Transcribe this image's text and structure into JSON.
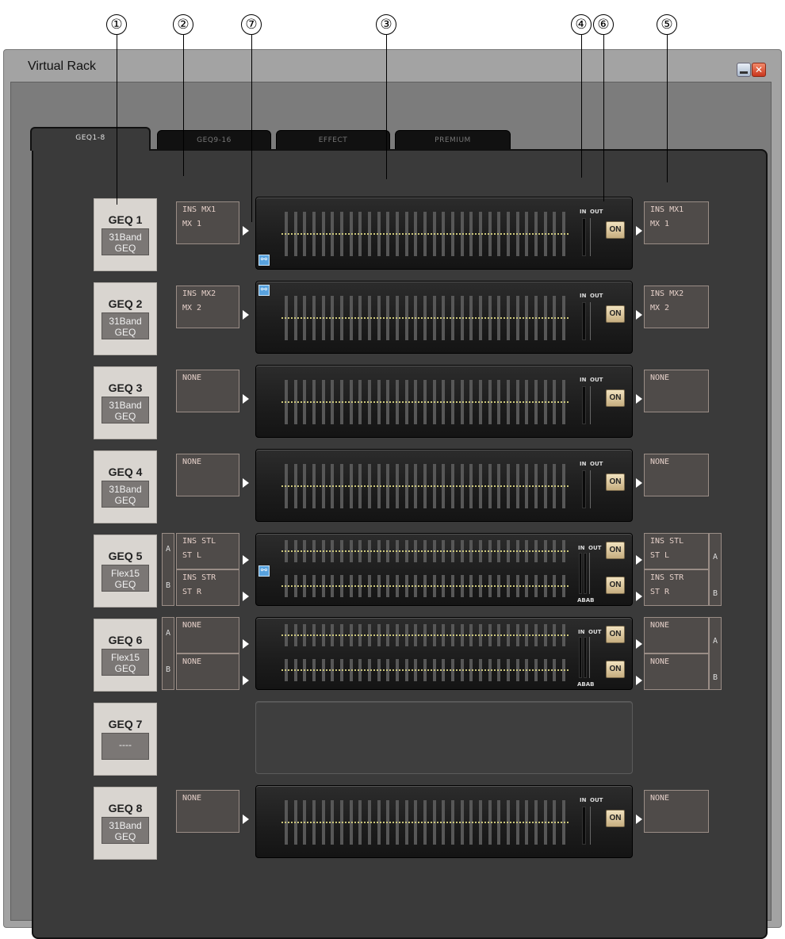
{
  "callouts": [
    "①",
    "②",
    "⑦",
    "③",
    "④",
    "⑥",
    "⑤"
  ],
  "window": {
    "title": "Virtual Rack"
  },
  "tabs": [
    "GEQ1-8",
    "GEQ9-16",
    "EFFECT",
    "PREMIUM"
  ],
  "on_label": "ON",
  "meter_in": "IN",
  "meter_out": "OUT",
  "ab": [
    "A",
    "B"
  ],
  "meter_ab": "ABAB",
  "geqs": [
    {
      "name": "GEQ 1",
      "type_l1": "31Band",
      "type_l2": "GEQ",
      "in_l1": "INS MX1",
      "in_l2": "MX 1",
      "out_l1": "INS MX1",
      "out_l2": "MX 1"
    },
    {
      "name": "GEQ 2",
      "type_l1": "31Band",
      "type_l2": "GEQ",
      "in_l1": "INS MX2",
      "in_l2": "MX 2",
      "out_l1": "INS MX2",
      "out_l2": "MX 2"
    },
    {
      "name": "GEQ 3",
      "type_l1": "31Band",
      "type_l2": "GEQ",
      "in_l1": "NONE",
      "out_l1": "NONE"
    },
    {
      "name": "GEQ 4",
      "type_l1": "31Band",
      "type_l2": "GEQ",
      "in_l1": "NONE",
      "out_l1": "NONE"
    },
    {
      "name": "GEQ 5",
      "type_l1": "Flex15",
      "type_l2": "GEQ",
      "a_in_l1": "INS STL",
      "a_in_l2": "ST L",
      "b_in_l1": "INS STR",
      "b_in_l2": "ST R",
      "a_out_l1": "INS STL",
      "a_out_l2": "ST L",
      "b_out_l1": "INS STR",
      "b_out_l2": "ST R"
    },
    {
      "name": "GEQ 6",
      "type_l1": "Flex15",
      "type_l2": "GEQ",
      "a_in_l1": "NONE",
      "b_in_l1": "NONE",
      "a_out_l1": "NONE",
      "b_out_l1": "NONE"
    },
    {
      "name": "GEQ 7",
      "type_l1": "----"
    },
    {
      "name": "GEQ 8",
      "type_l1": "31Band",
      "type_l2": "GEQ",
      "in_l1": "NONE",
      "out_l1": "NONE"
    }
  ]
}
